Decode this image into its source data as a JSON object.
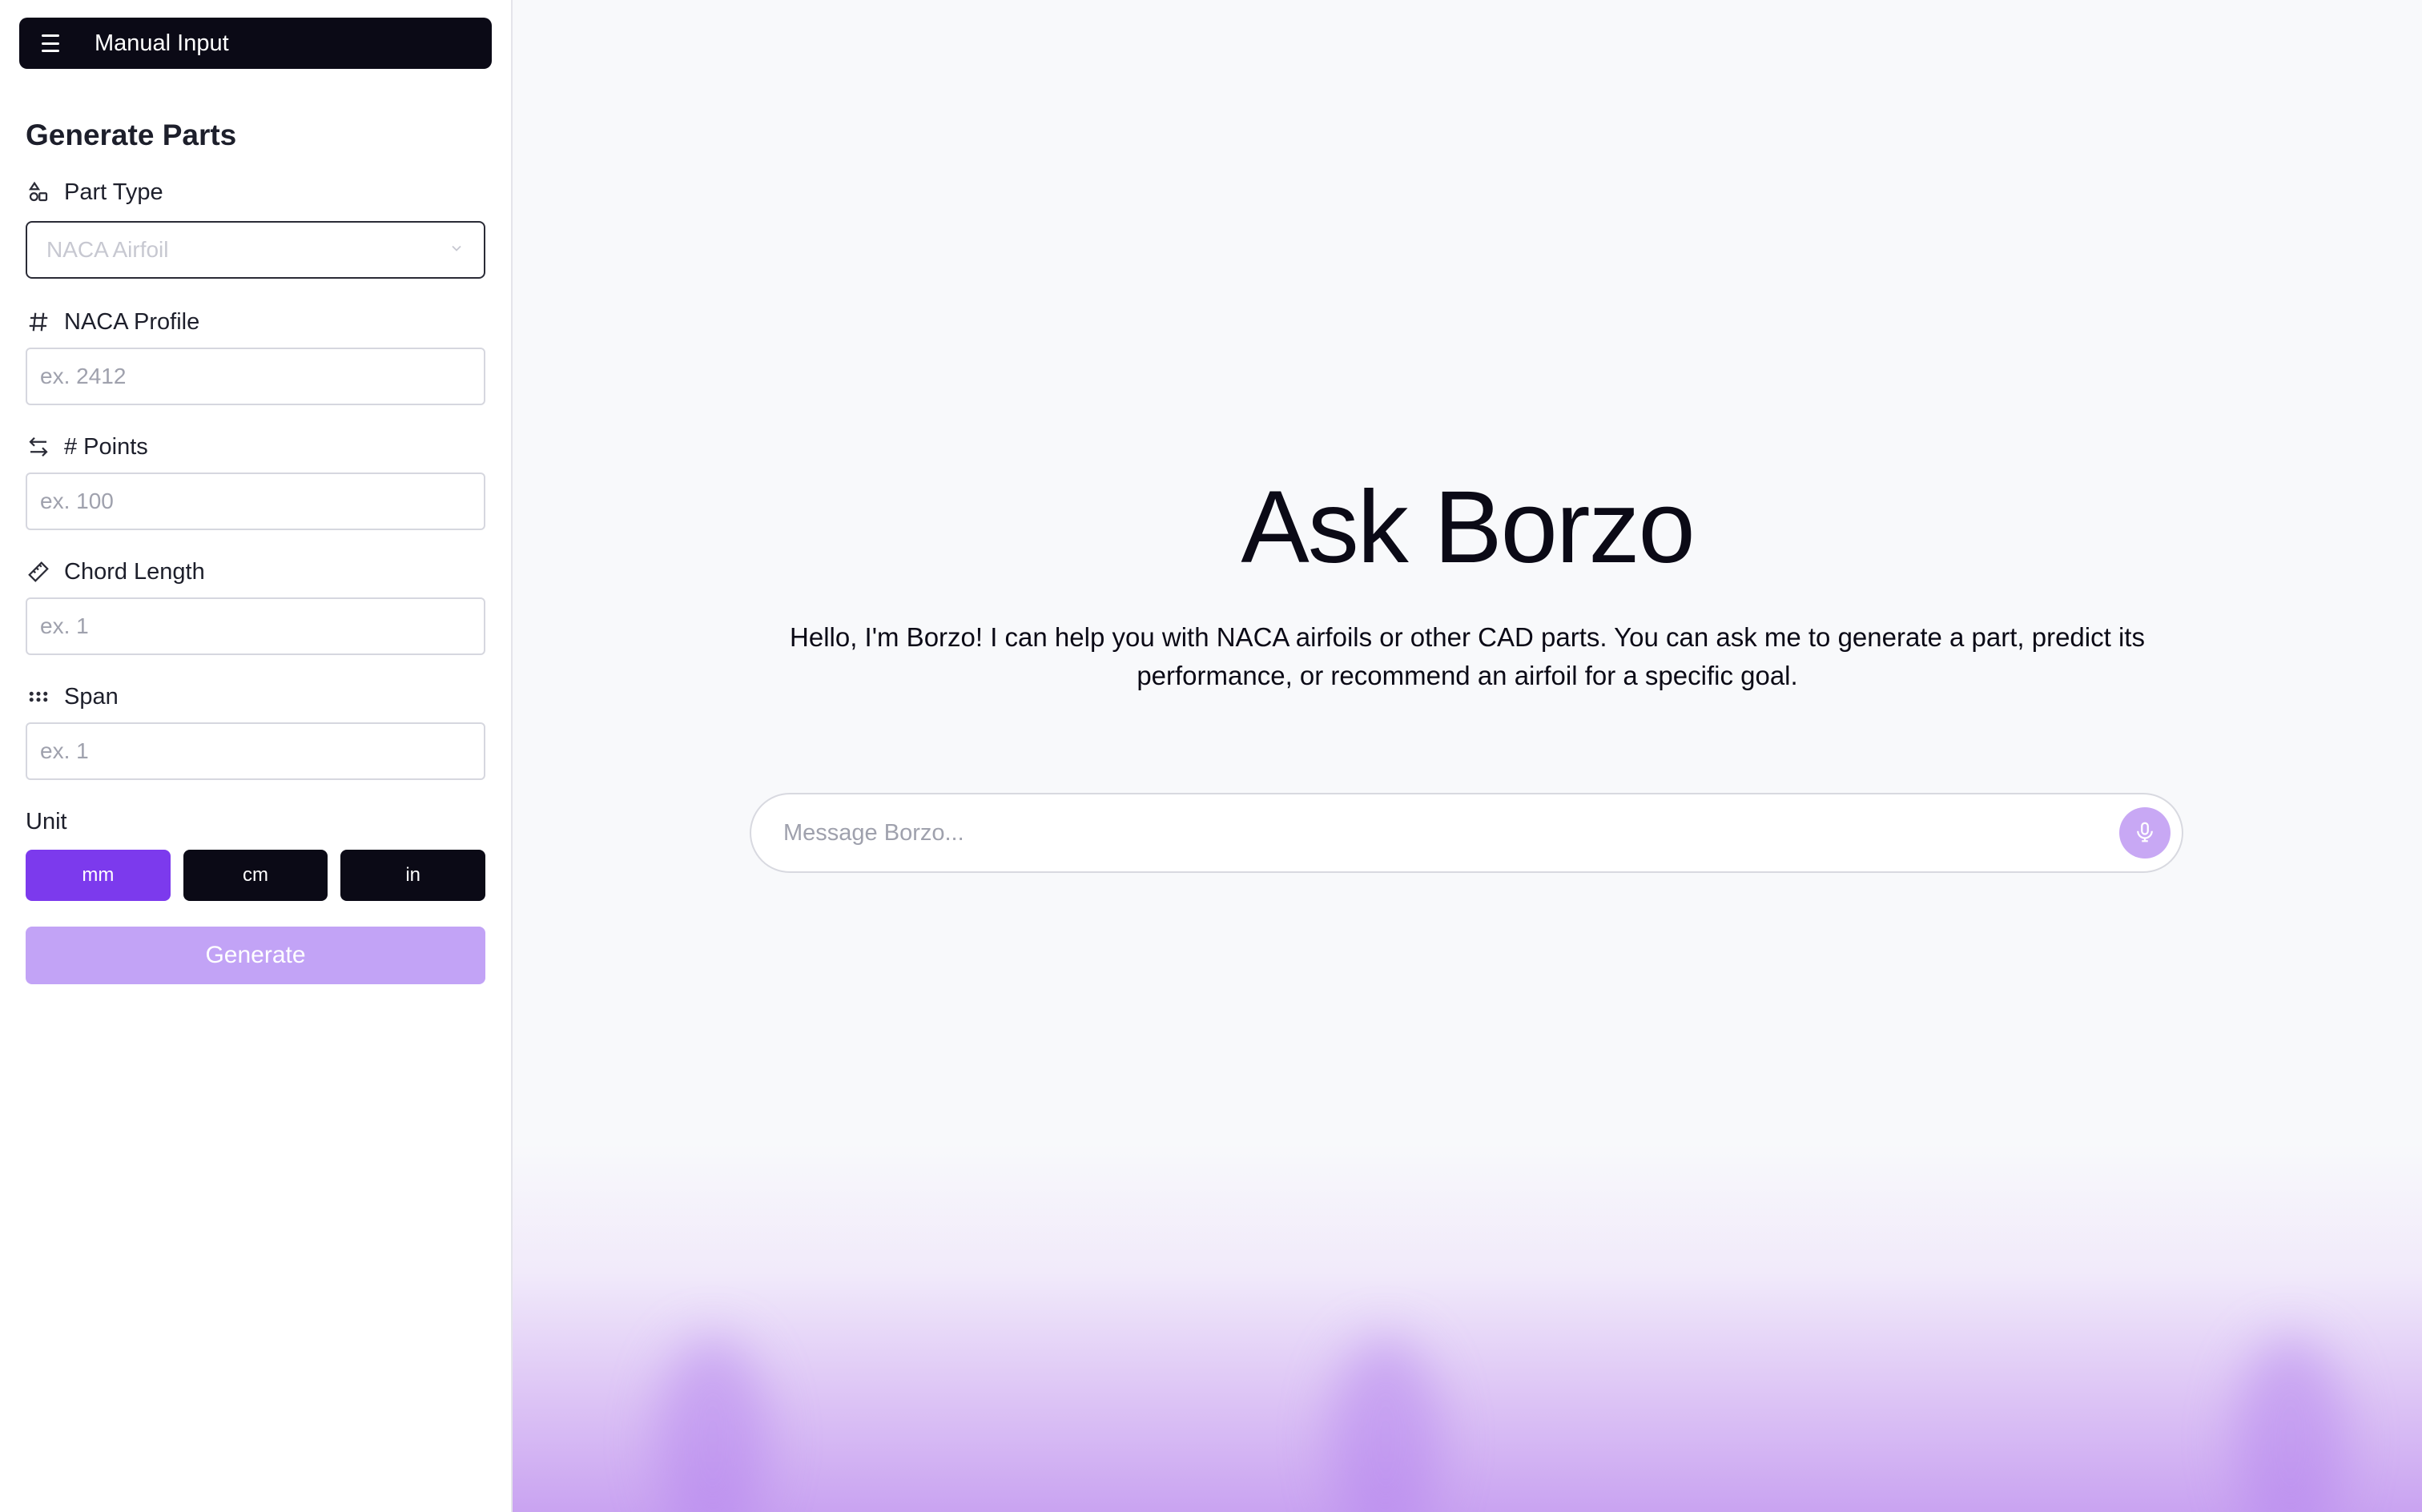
{
  "sidebar": {
    "topbar": {
      "title": "Manual Input",
      "icon": "hamburger-menu-icon"
    },
    "section_title": "Generate Parts",
    "part_type": {
      "label": "Part Type",
      "icon": "shapes-icon",
      "value": "NACA Airfoil"
    },
    "naca_profile": {
      "label": "NACA Profile",
      "icon": "hash-icon",
      "placeholder": "ex. 2412"
    },
    "points": {
      "label": "# Points",
      "icon": "swap-arrows-icon",
      "placeholder": "ex. 100"
    },
    "chord_length": {
      "label": "Chord Length",
      "icon": "ruler-icon",
      "placeholder": "ex. 1"
    },
    "span": {
      "label": "Span",
      "icon": "dots-grid-icon",
      "placeholder": "ex. 1"
    },
    "unit": {
      "label": "Unit",
      "options": [
        "mm",
        "cm",
        "in"
      ],
      "selected": "mm"
    },
    "generate_label": "Generate"
  },
  "main": {
    "title": "Ask Borzo",
    "subtitle": "Hello, I'm Borzo! I can help you with NACA airfoils or other CAD parts. You can ask me to generate a part, predict its performance, or recommend an airfoil for a specific goal.",
    "chat": {
      "placeholder": "Message Borzo...",
      "mic_icon": "microphone-icon"
    }
  },
  "colors": {
    "accent": "#7c3aed",
    "accent_light": "#c2a3f6",
    "dark": "#0b0a16"
  }
}
